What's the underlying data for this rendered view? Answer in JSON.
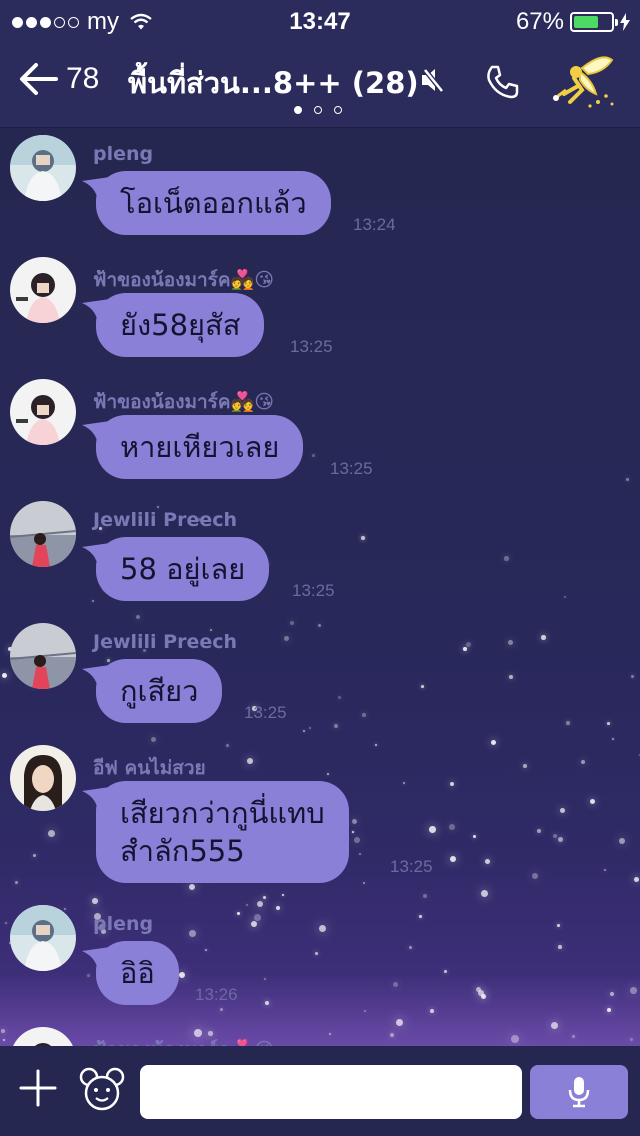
{
  "status_bar": {
    "carrier": "my",
    "time": "13:47",
    "battery": "67%",
    "battery_level": 0.67,
    "signal_strength": 3
  },
  "header": {
    "unread_count": "78",
    "title": "พื้นที่ส่วน...8++ (28)",
    "page_indicator": {
      "count": 3,
      "active": 0
    }
  },
  "messages": [
    {
      "sender": "pleng",
      "text": "โอเน็ตออกแล้ว",
      "time": "13:24"
    },
    {
      "sender": "ฟ้าของน้องมาร์ค💑😘",
      "text": "ยัง58ยุสัส",
      "time": "13:25"
    },
    {
      "sender": "ฟ้าของน้องมาร์ค💑😘",
      "text": "หายเหียวเลย",
      "time": "13:25"
    },
    {
      "sender": "Jewlili Preech",
      "text": "58 อยู่เลย",
      "time": "13:25"
    },
    {
      "sender": "Jewlili Preech",
      "text": "กูเสียว",
      "time": "13:25"
    },
    {
      "sender": "อีฟ คนไม่สวย",
      "text_line1": "เสียวกว่ากูนี่แทบ",
      "text_line2": "สำลัก555",
      "time": "13:25"
    },
    {
      "sender": "pleng",
      "text": "อิอิ",
      "time": "13:26"
    },
    {
      "sender": "ฟ้าของน้องมาร์ค💑😘"
    }
  ],
  "composer": {
    "value": "",
    "placeholder": ""
  },
  "colors": {
    "header_bg": "#2b2c5b",
    "chat_bg": "#262750",
    "bubble": "#8b80d8",
    "sender_name": "#7a79b5",
    "timestamp": "#6b6ba0",
    "battery": "#4cd964"
  },
  "icons": {
    "back": "arrow-left-icon",
    "mute": "speaker-muted-icon",
    "call": "phone-icon",
    "profile": "fairy-icon",
    "add": "plus-icon",
    "sticker": "bear-icon",
    "voice": "microphone-icon"
  }
}
